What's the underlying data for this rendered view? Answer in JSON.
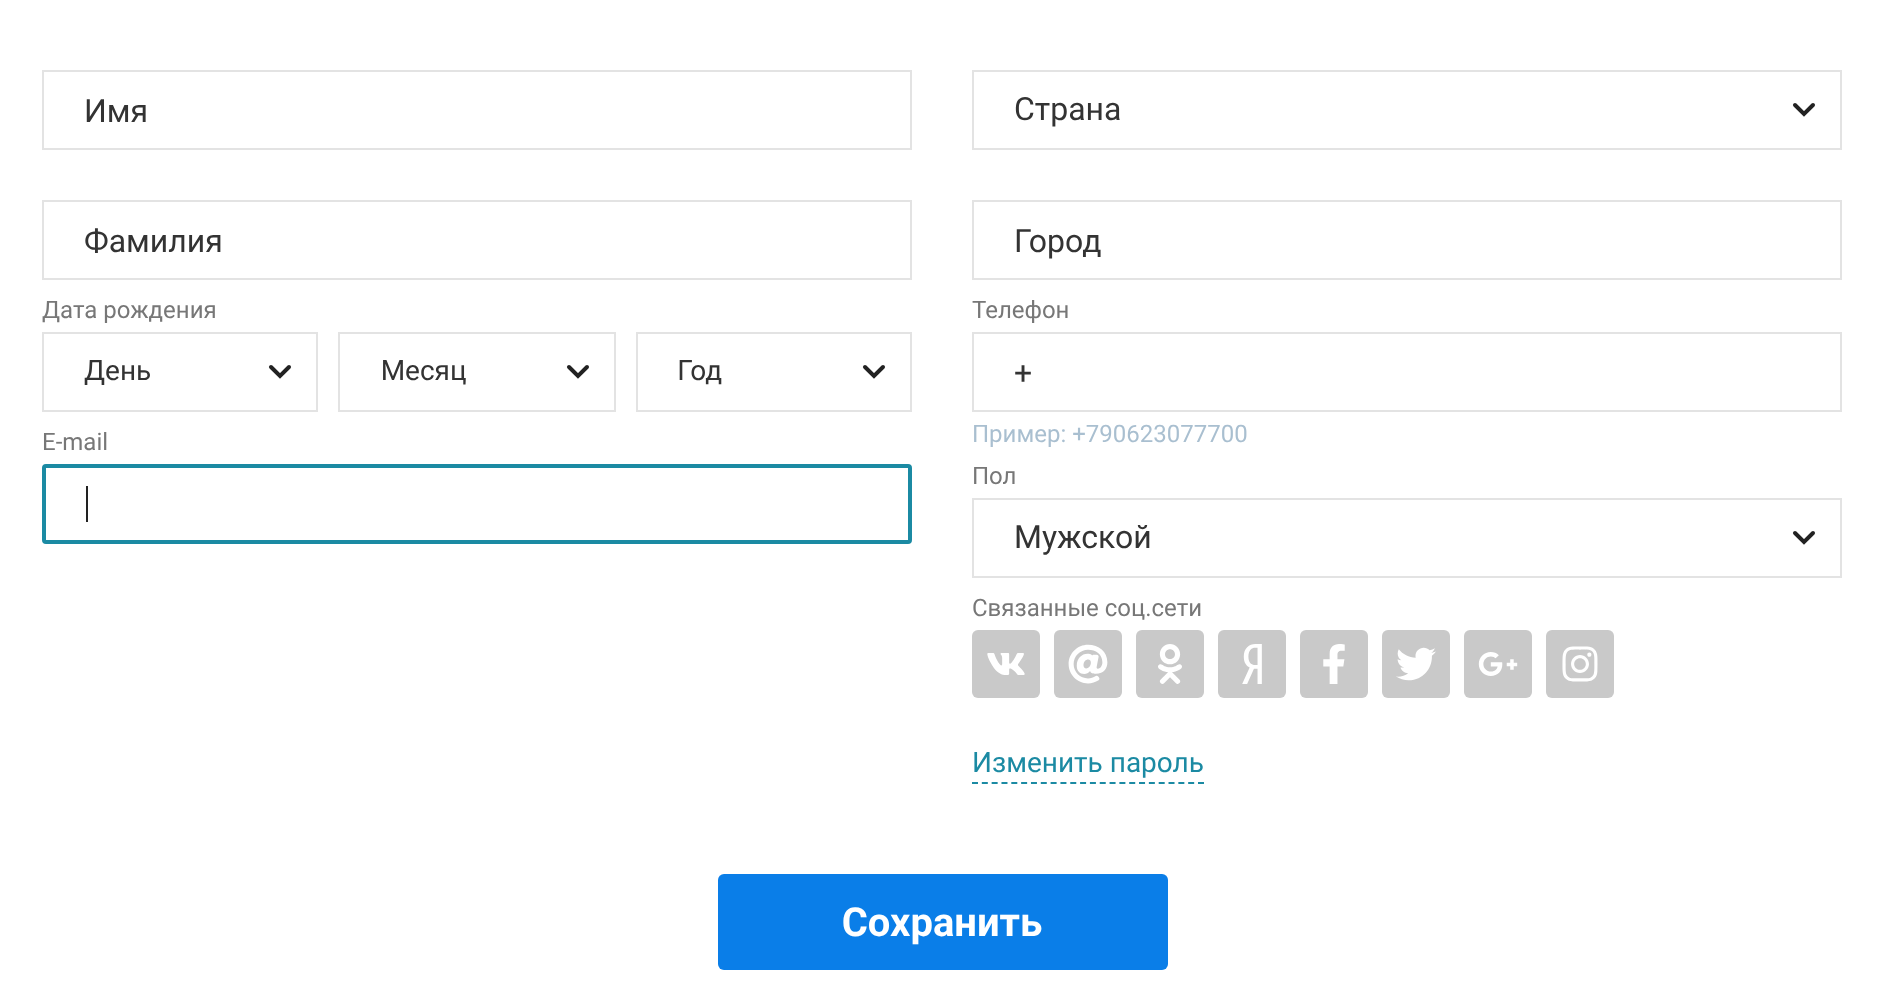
{
  "first_name": {
    "placeholder": "Имя"
  },
  "country": {
    "value": "Страна"
  },
  "last_name": {
    "placeholder": "Фамилия"
  },
  "city": {
    "placeholder": "Город"
  },
  "birth_date": {
    "label": "Дата рождения",
    "selects": [
      {
        "value": "День"
      },
      {
        "value": "Месяц"
      },
      {
        "value": "Год"
      }
    ]
  },
  "phone": {
    "label": "Телефон",
    "value": "+",
    "hint": "Пример: +790623077700"
  },
  "email": {
    "label": "E-mail",
    "focused": true
  },
  "gender": {
    "label": "Пол",
    "value": "Мужской"
  },
  "social": {
    "label": "Связанные соц.сети",
    "networks": [
      {
        "kind": "vk"
      },
      {
        "kind": "at"
      },
      {
        "kind": "ok"
      },
      {
        "kind": "ya"
      },
      {
        "kind": "facebook"
      },
      {
        "kind": "twitter"
      },
      {
        "kind": "googleplus"
      },
      {
        "kind": "instagram"
      }
    ]
  },
  "change_password": "Изменить пароль",
  "save_button": "Сохранить"
}
